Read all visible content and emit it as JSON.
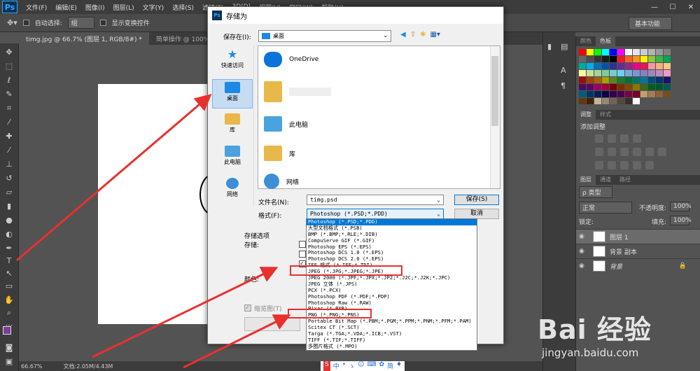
{
  "menubar": {
    "logo": "Ps",
    "items": [
      "文件(F)",
      "编辑(E)",
      "图像(I)",
      "图层(L)",
      "文字(Y)",
      "选择(S)",
      "滤镜(T)",
      "3D(D)",
      "视图(V)",
      "窗口(W)",
      "帮助(H)"
    ],
    "win_min": "—",
    "win_max": "☐",
    "win_close": "✕"
  },
  "optbar": {
    "auto_select_label": "自动选择:",
    "auto_select_value": "组",
    "show_transform_label": "显示变换控件",
    "workspace": "基本功能"
  },
  "tabs": [
    "timg.jpg @ 66.7% (图层 1, RGB/8#) *",
    "简单操作 @ 100% (图..."
  ],
  "statusbar": {
    "zoom": "66.67%",
    "doc": "文档:2.05M/4.43M"
  },
  "panels": {
    "swatch_tabs": [
      "颜色",
      "色板"
    ],
    "adjust_tabs": [
      "调整",
      "样式"
    ],
    "adjust_title": "添加调整",
    "layer_tabs": [
      "图层",
      "通道",
      "路径"
    ],
    "kind_label": "ρ 类型",
    "blend_mode": "正常",
    "opacity_label": "不透明度:",
    "opacity_value": "100%",
    "lock_label": "锁定:",
    "fill_label": "填充:",
    "fill_value": "100%",
    "layers": [
      "图层 1",
      "背景 副本",
      "背景"
    ]
  },
  "dialog": {
    "title": "存储为",
    "save_in_label": "保存在(I):",
    "save_in_value": "桌面",
    "places": [
      "快速访问",
      "桌面",
      "库",
      "此电脑",
      "网络"
    ],
    "files": [
      "OneDrive",
      "",
      "此电脑",
      "库",
      "网络"
    ],
    "filename_label": "文件名(N):",
    "filename_value": "timg.psd",
    "format_label": "格式(F):",
    "format_value": "Photoshop (*.PSD;*.PDD)",
    "save_button": "保存(S)",
    "cancel_button": "取消",
    "save_options_label": "存储选项",
    "save_label": "存储:",
    "color_label": "颜色:",
    "thumbnail_label": "缩览图(T)",
    "format_options": [
      "Photoshop (*.PSD;*.PDD)",
      "大型文档格式 (*.PSB)",
      "BMP (*.BMP;*.RLE;*.DIB)",
      "CompuServe GIF (*.GIF)",
      "Photoshop EPS (*.EPS)",
      "Photoshop DCS 1.0 (*.EPS)",
      "Photoshop DCS 2.0 (*.EPS)",
      "IFF 格式 (*.IFF;*.TDI)",
      "JPEG (*.JPG;*.JPEG;*.JPE)",
      "JPEG 2000 (*.JPF;*.JPX;*.JP2;*.J2C;*.J2K;*.JPC)",
      "JPEG 立体 (*.JPS)",
      "PCX (*.PCX)",
      "Photoshop PDF (*.PDF;*.PDP)",
      "Photoshop Raw (*.RAW)",
      "Pixar (*.PXR)",
      "PNG (*.PNG;*.PNS)",
      "Portable Bit Map (*.PBM;*.PGM;*.PPM;*.PNM;*.PFM;*.PAM)",
      "Scitex CT (*.SCT)",
      "Targa (*.TGA;*.VDA;*.ICB;*.VST)",
      "TIFF (*.TIF;*.TIFF)",
      "多图片格式 (*.MPO)"
    ]
  },
  "watermark": {
    "brand": "Bai 经验",
    "url": "jingyan.baidu.com"
  },
  "ime": [
    "S",
    "中",
    "•",
    "ゝ",
    "☺",
    "⌨",
    "✿",
    "简",
    "♦"
  ],
  "colors": {
    "arrow": "#e8312f",
    "ps_blue": "#31a8ff",
    "selection": "#0078d7"
  }
}
